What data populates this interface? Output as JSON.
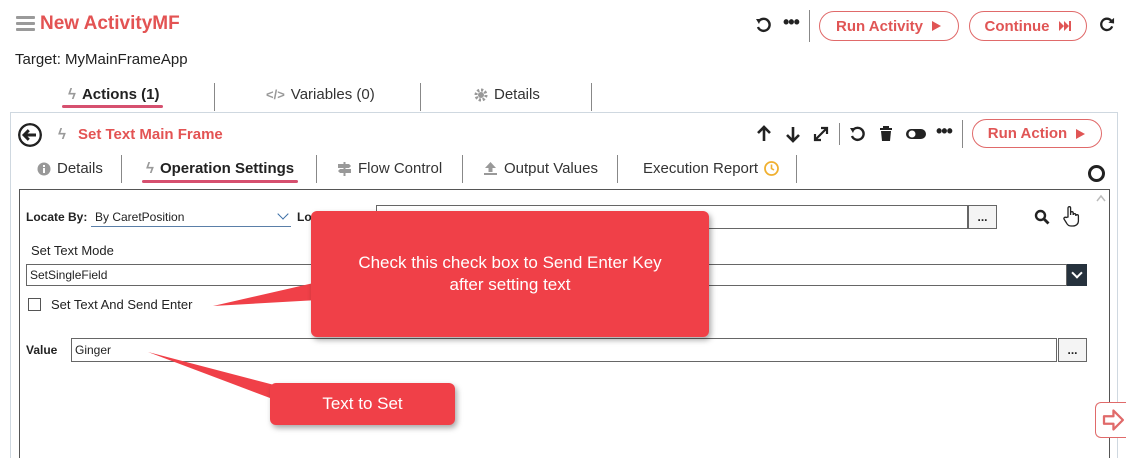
{
  "header": {
    "title": "New ActivityMF",
    "target_label": "Target: MyMainFrameApp",
    "run_activity_label": "Run Activity",
    "continue_label": "Continue",
    "more_label": "•••"
  },
  "outer_tabs": [
    {
      "label": "Actions (1)",
      "icon": "bolt-icon",
      "active": true
    },
    {
      "label": "Variables (0)",
      "icon": "code-icon",
      "active": false
    },
    {
      "label": "Details",
      "icon": "gear-icon",
      "active": false
    }
  ],
  "action": {
    "title": "Set Text Main Frame",
    "run_action_label": "Run Action",
    "more_label": "•••"
  },
  "inner_tabs": [
    {
      "label": "Details",
      "icon": "info-icon",
      "active": false
    },
    {
      "label": "Operation Settings",
      "icon": "bolt-icon",
      "active": true
    },
    {
      "label": "Flow Control",
      "icon": "signpost-icon",
      "active": false
    },
    {
      "label": "Output Values",
      "icon": "upload-icon",
      "active": false
    },
    {
      "label": "Execution Report",
      "icon": "clock-icon",
      "active": false
    }
  ],
  "form": {
    "locate_by_label": "Locate By:",
    "locate_by_value": "By CaretPosition",
    "locate_value_label": "Lo",
    "locate_value": "",
    "set_text_mode_label": "Set Text Mode",
    "set_text_mode_value": "SetSingleField",
    "send_enter_label": "Set Text And Send Enter",
    "send_enter_checked": false,
    "value_label": "Value",
    "value": "Ginger",
    "browse_label": "..."
  },
  "callouts": {
    "checkbox_tip": "Check this check box to Send Enter Key after setting text",
    "value_tip": "Text to Set"
  },
  "colors": {
    "accent": "#e35353",
    "tab_underline": "#d6506f",
    "callout": "#f04048"
  }
}
